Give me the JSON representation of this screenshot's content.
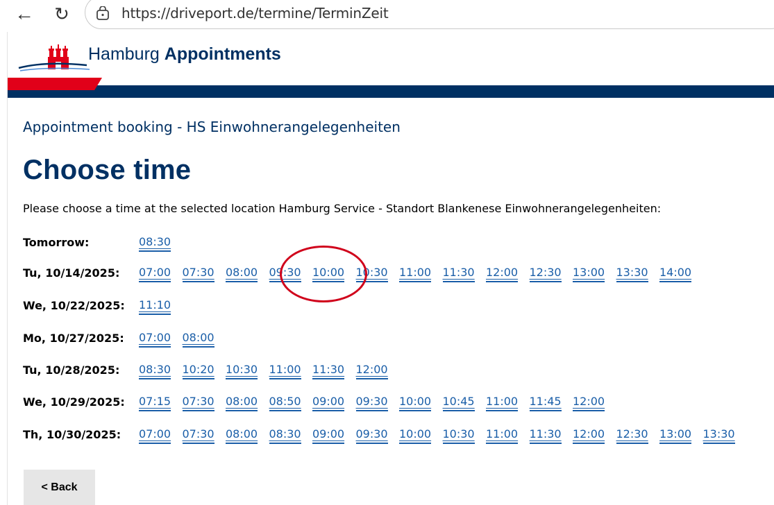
{
  "browser": {
    "url": "https://driveport.de/termine/TerminZeit"
  },
  "header": {
    "brand_regular": "Hamburg",
    "brand_bold": "Appointments"
  },
  "breadcrumb": "Appointment booking - HS Einwohnerangelegenheiten",
  "page_title": "Choose time",
  "instruction": "Please choose a time at the selected location Hamburg Service - Standort Blankenese Einwohnerangelegenheiten:",
  "days": [
    {
      "label": "Tomorrow:",
      "slots": [
        "08:30"
      ]
    },
    {
      "label": "Tu, 10/14/2025:",
      "slots": [
        "07:00",
        "07:30",
        "08:00",
        "09:30",
        "10:00",
        "10:30",
        "11:00",
        "11:30",
        "12:00",
        "12:30",
        "13:00",
        "13:30",
        "14:00"
      ]
    },
    {
      "label": "We, 10/22/2025:",
      "slots": [
        "11:10"
      ]
    },
    {
      "label": "Mo, 10/27/2025:",
      "slots": [
        "07:00",
        "08:00"
      ]
    },
    {
      "label": "Tu, 10/28/2025:",
      "slots": [
        "08:30",
        "10:20",
        "10:30",
        "11:00",
        "11:30",
        "12:00"
      ]
    },
    {
      "label": "We, 10/29/2025:",
      "slots": [
        "07:15",
        "07:30",
        "08:00",
        "08:50",
        "09:00",
        "09:30",
        "10:00",
        "10:45",
        "11:00",
        "11:45",
        "12:00"
      ]
    },
    {
      "label": "Th, 10/30/2025:",
      "slots": [
        "07:00",
        "07:30",
        "08:00",
        "08:30",
        "09:00",
        "09:30",
        "10:00",
        "10:30",
        "11:00",
        "11:30",
        "12:00",
        "12:30",
        "13:00",
        "13:30"
      ]
    }
  ],
  "back_button": "< Back",
  "colors": {
    "brand_blue": "#003063",
    "brand_red": "#e10019",
    "link_blue": "#1a5ea8",
    "annotation_red": "#d0021b"
  },
  "icons": [
    "back-arrow-icon",
    "reload-icon",
    "site-info-icon",
    "hamburg-castle-logo"
  ]
}
